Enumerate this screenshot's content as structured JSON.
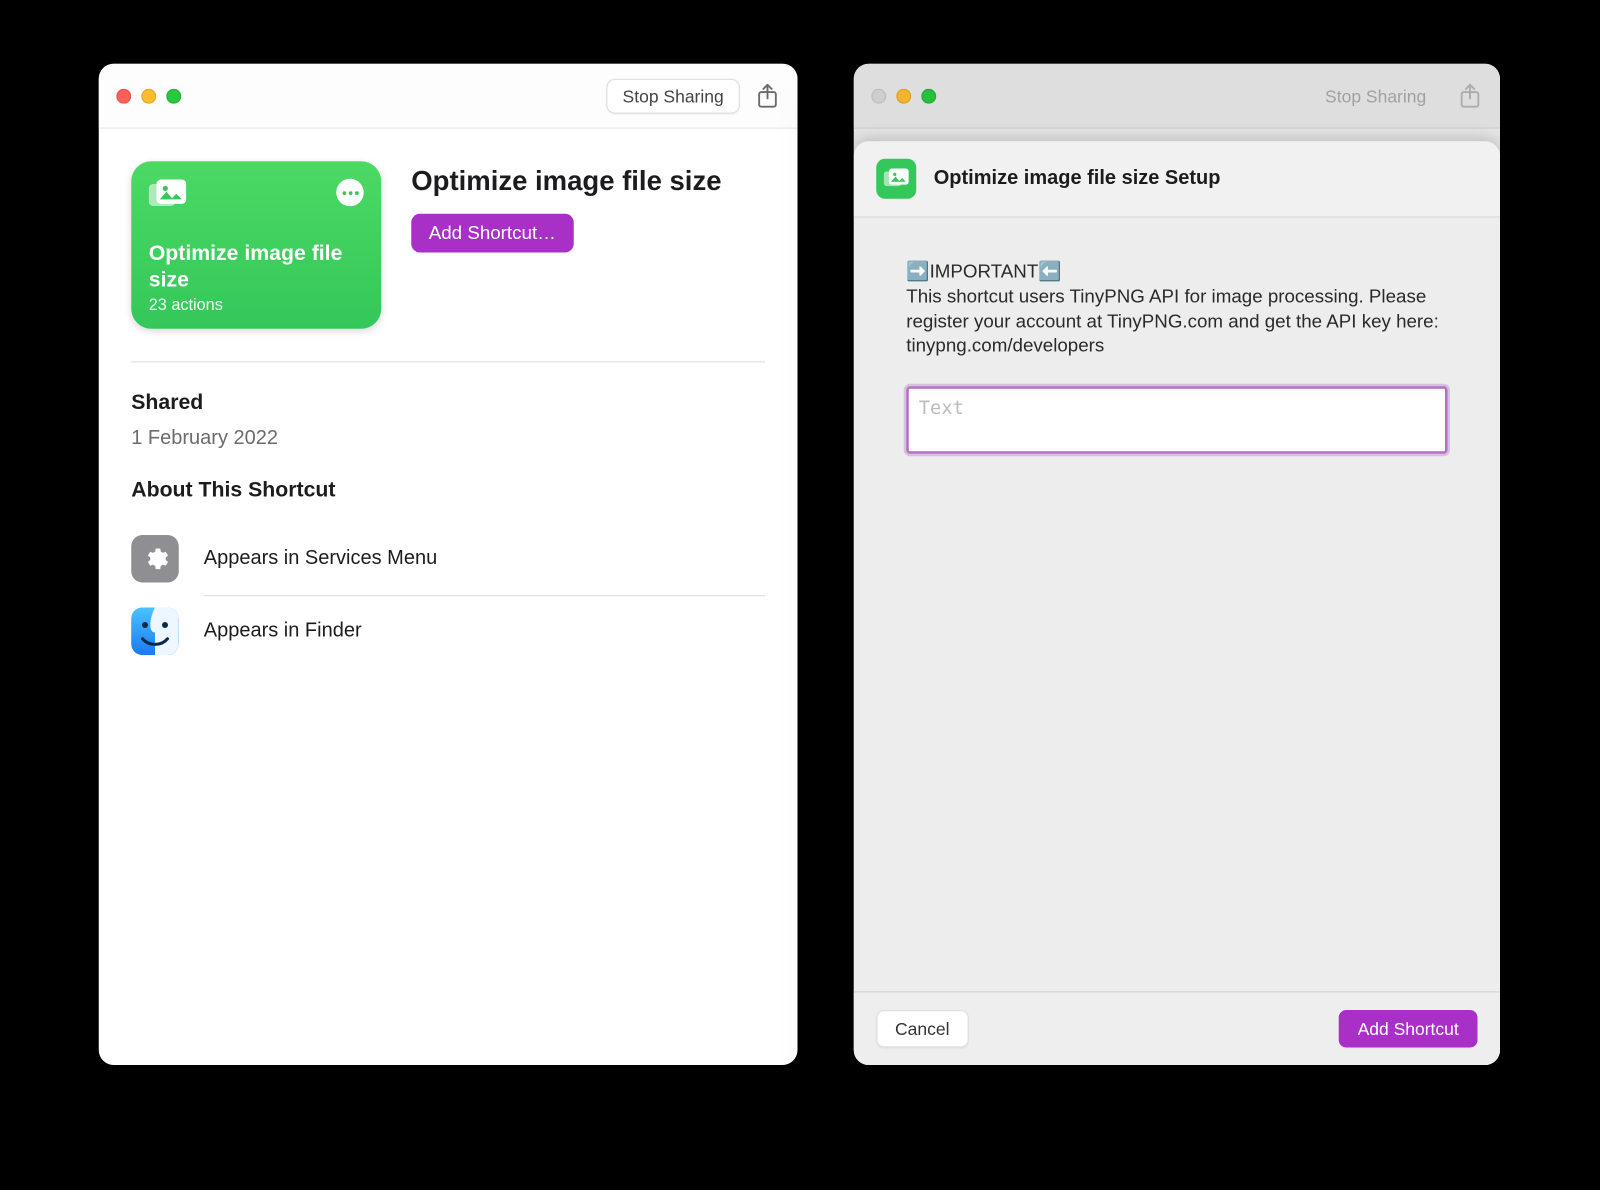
{
  "left": {
    "toolbar": {
      "stop_sharing": "Stop Sharing"
    },
    "card": {
      "title": "Optimize image file size",
      "subtitle": "23 actions"
    },
    "header": {
      "title": "Optimize image file size",
      "add_button": "Add Shortcut…"
    },
    "shared": {
      "heading": "Shared",
      "date": "1 February 2022"
    },
    "about": {
      "heading": "About This Shortcut",
      "items": [
        {
          "label": "Appears in Services Menu"
        },
        {
          "label": "Appears in Finder"
        }
      ]
    }
  },
  "right": {
    "toolbar": {
      "stop_sharing": "Stop Sharing"
    },
    "sheet": {
      "title": "Optimize image file size Setup",
      "message": "➡️IMPORTANT⬅️\nThis shortcut users TinyPNG API for image processing. Please register your account at TinyPNG.com and get the API key here: tinypng.com/developers",
      "input_placeholder": "Text",
      "cancel": "Cancel",
      "add": "Add Shortcut"
    }
  }
}
